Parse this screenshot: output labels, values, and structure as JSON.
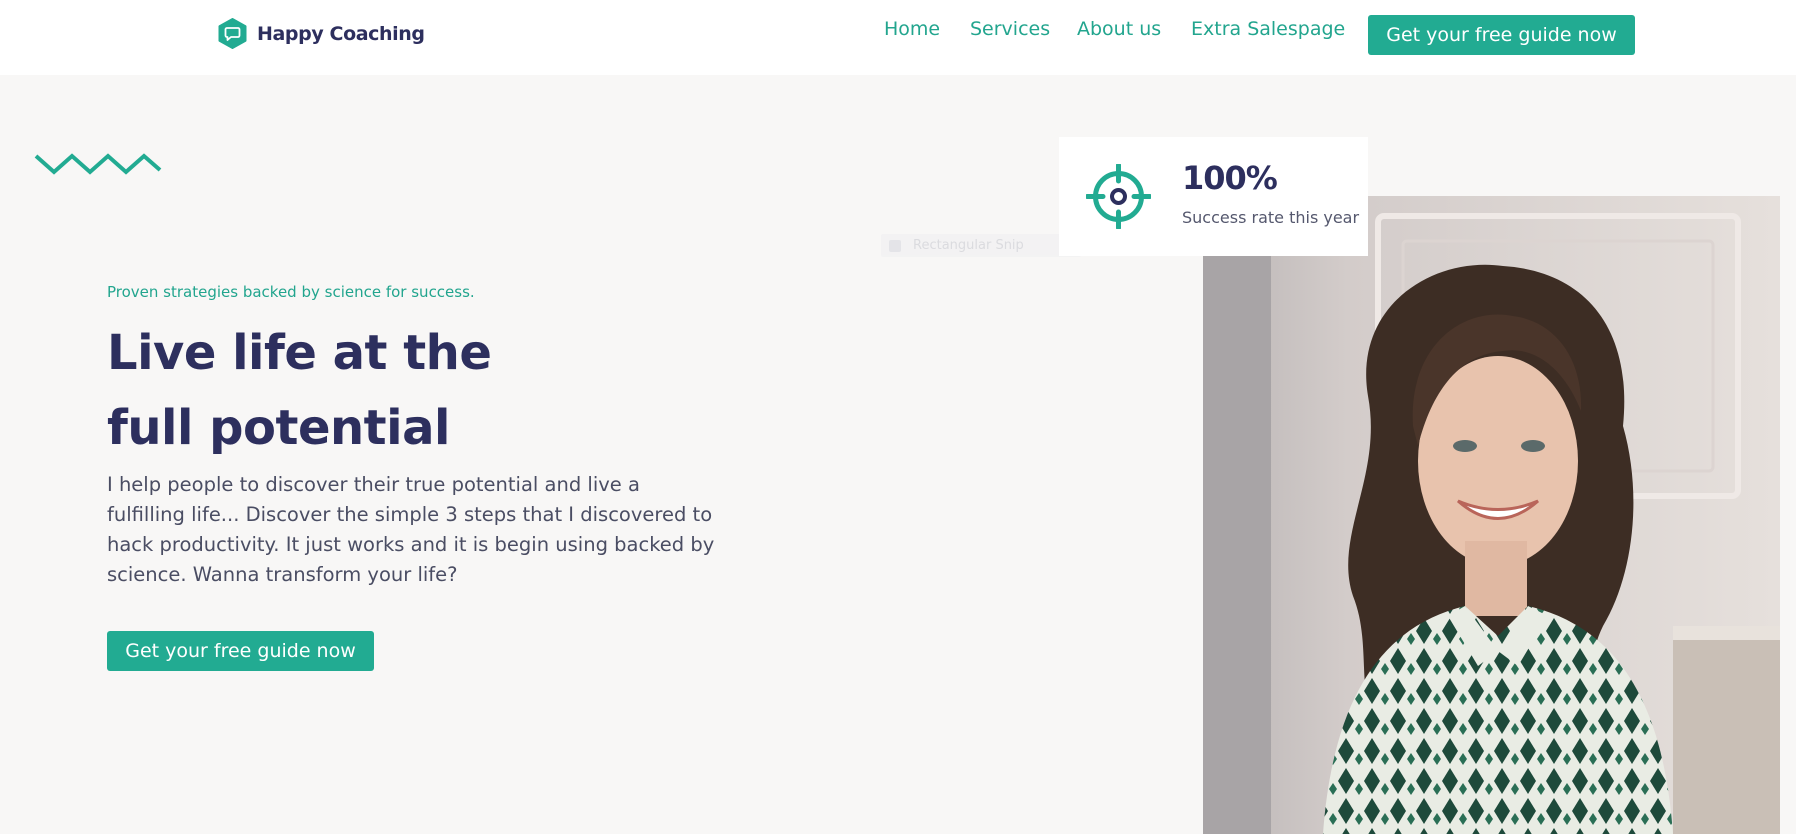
{
  "brand": {
    "name": "Happy Coaching",
    "accent": "#22ab92",
    "heading_color": "#2d2f5e",
    "logo_icon": "chat-bubble-icon"
  },
  "nav": {
    "items": [
      {
        "label": "Home"
      },
      {
        "label": "Services"
      },
      {
        "label": "About us"
      },
      {
        "label": "Extra Salespage"
      }
    ],
    "cta_label": "Get your free guide now"
  },
  "hero": {
    "eyebrow": "Proven strategies backed by science for success.",
    "headline_line1": "Live life at the",
    "headline_line2": "full potential",
    "body": "I help people to discover their true potential and live a fulfilling life... Discover the simple 3 steps that I discovered to hack productivity. It just works and it is begin using backed by science. Wanna transform your life?",
    "cta_label": "Get your free guide now"
  },
  "stat_card": {
    "icon": "target-icon",
    "value": "100%",
    "label": "Success rate this year"
  },
  "ghost_tooltip": {
    "label": "Rectangular Snip"
  }
}
